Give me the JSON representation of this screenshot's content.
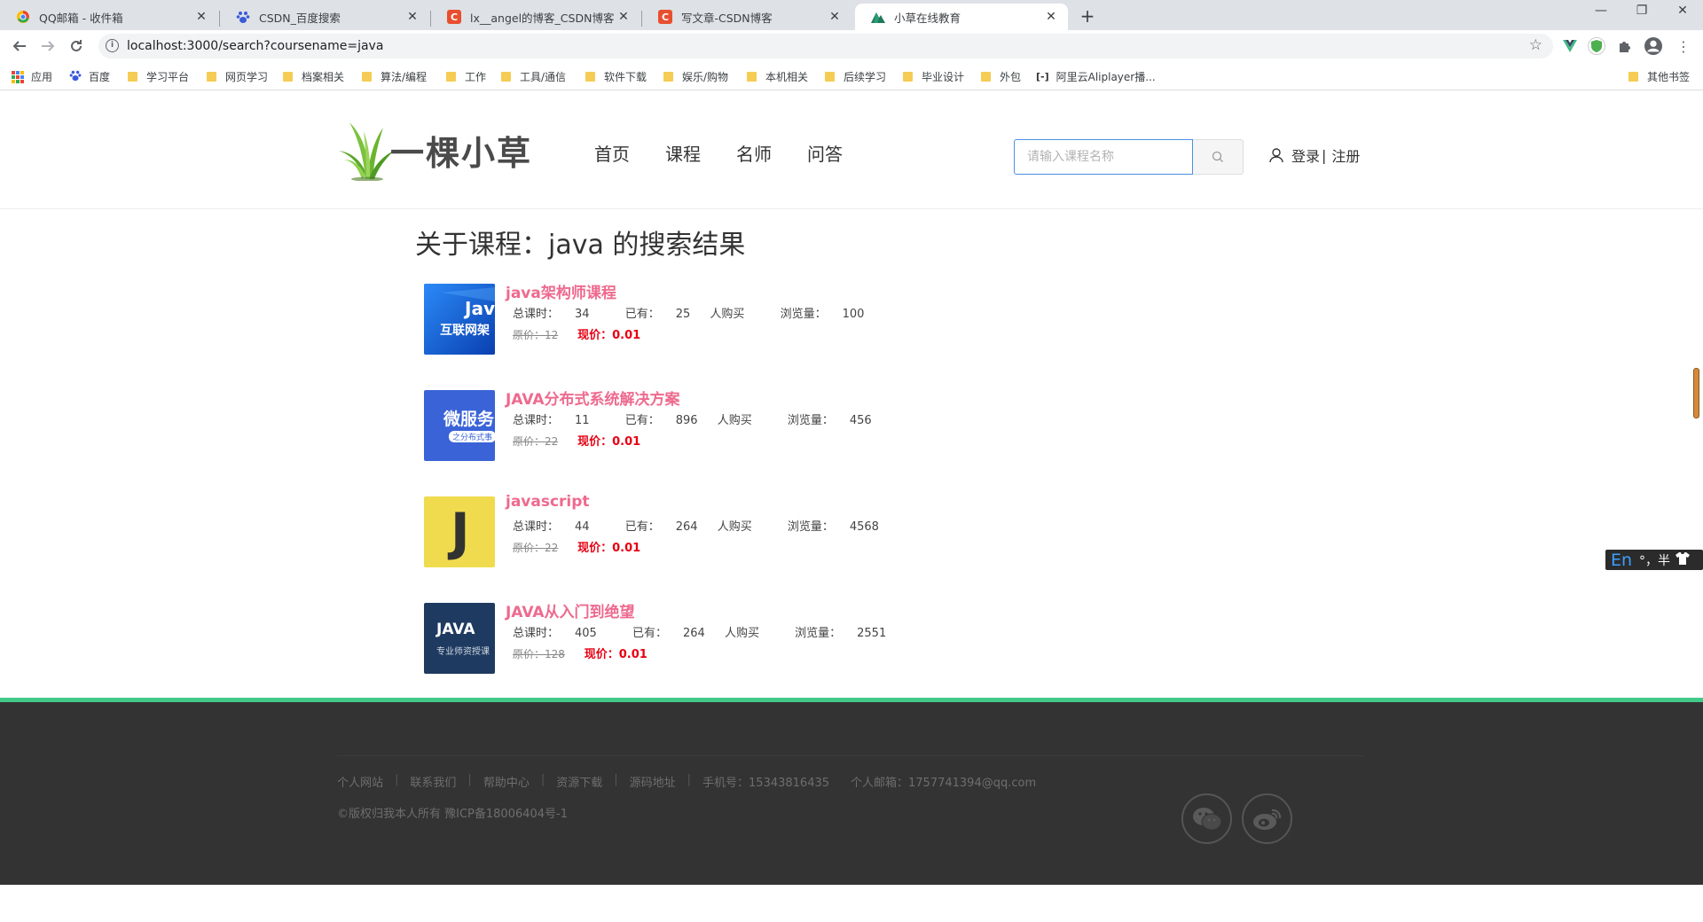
{
  "browser": {
    "tabs": [
      {
        "title": "QQ邮箱 - 收件箱",
        "icon": "qq-mail-icon",
        "active": false
      },
      {
        "title": "CSDN_百度搜索",
        "icon": "baidu-icon",
        "active": false
      },
      {
        "title": "lx__angel的博客_CSDN博客-JAVA",
        "icon": "csdn-icon",
        "active": false
      },
      {
        "title": "写文章-CSDN博客",
        "icon": "csdn-icon",
        "active": false
      },
      {
        "title": "小草在线教育",
        "icon": "grass-icon",
        "active": true
      }
    ],
    "url": "localhost:3000/search?coursename=java",
    "bookmarks": [
      "应用",
      "百度",
      "学习平台",
      "网页学习",
      "档案相关",
      "算法/编程",
      "工作",
      "工具/通信",
      "软件下载",
      "娱乐/购物",
      "本机相关",
      "后续学习",
      "毕业设计",
      "外包",
      "阿里云Aliplayer播...",
      "其他书签"
    ]
  },
  "header": {
    "logo_text": "一棵小草",
    "nav": [
      "首页",
      "课程",
      "名师",
      "问答"
    ],
    "search_placeholder": "请输入课程名称",
    "login": "登录",
    "divider": "|",
    "register": "注册"
  },
  "results": {
    "title": "关于课程：java 的搜索结果",
    "courses": [
      {
        "name": "java架构师课程",
        "hours_label": "总课时：",
        "hours": "34",
        "bought_label": "已有：",
        "bought": "25",
        "bought_suffix": "人购买",
        "views_label": "浏览量：",
        "views": "100",
        "orig_label": "原价：",
        "orig": "12",
        "now_label": "现价：",
        "now": "0.01",
        "thumb_text1": "Jav",
        "thumb_text2": "互联网架"
      },
      {
        "name": "JAVA分布式系统解决方案",
        "hours_label": "总课时：",
        "hours": "11",
        "bought_label": "已有：",
        "bought": "896",
        "bought_suffix": "人购买",
        "views_label": "浏览量：",
        "views": "456",
        "orig_label": "原价：",
        "orig": "22",
        "now_label": "现价：",
        "now": "0.01",
        "thumb_text1": "微服务",
        "thumb_text2": "之分布式事"
      },
      {
        "name": "javascript",
        "hours_label": "总课时：",
        "hours": "44",
        "bought_label": "已有：",
        "bought": "264",
        "bought_suffix": "人购买",
        "views_label": "浏览量：",
        "views": "4568",
        "orig_label": "原价：",
        "orig": "22",
        "now_label": "现价：",
        "now": "0.01",
        "thumb_text1": "J",
        "thumb_text2": ""
      },
      {
        "name": "JAVA从入门到绝望",
        "hours_label": "总课时：",
        "hours": "405",
        "bought_label": "已有：",
        "bought": "264",
        "bought_suffix": "人购买",
        "views_label": "浏览量：",
        "views": "2551",
        "orig_label": "原价：",
        "orig": "128",
        "now_label": "现价：",
        "now": "0.01",
        "thumb_text1": "JAVA",
        "thumb_text2": "专业师资授课"
      }
    ]
  },
  "footer": {
    "links": [
      "个人网站",
      "联系我们",
      "帮助中心",
      "资源下载",
      "源码地址"
    ],
    "phone": "手机号：15343816435",
    "email": "个人邮箱：1757741394@qq.com",
    "copyright": "©版权归我本人所有 豫ICP备18006404号-1",
    "social": [
      "wechat-icon",
      "weibo-icon"
    ]
  },
  "ime": {
    "mode": "En",
    "punct": "°，半"
  },
  "colors": {
    "accent": "#ee6a8e",
    "price": "#e60012",
    "footer_bg": "#333333",
    "footer_border": "#43c98a",
    "search_border": "#4a90e2"
  }
}
